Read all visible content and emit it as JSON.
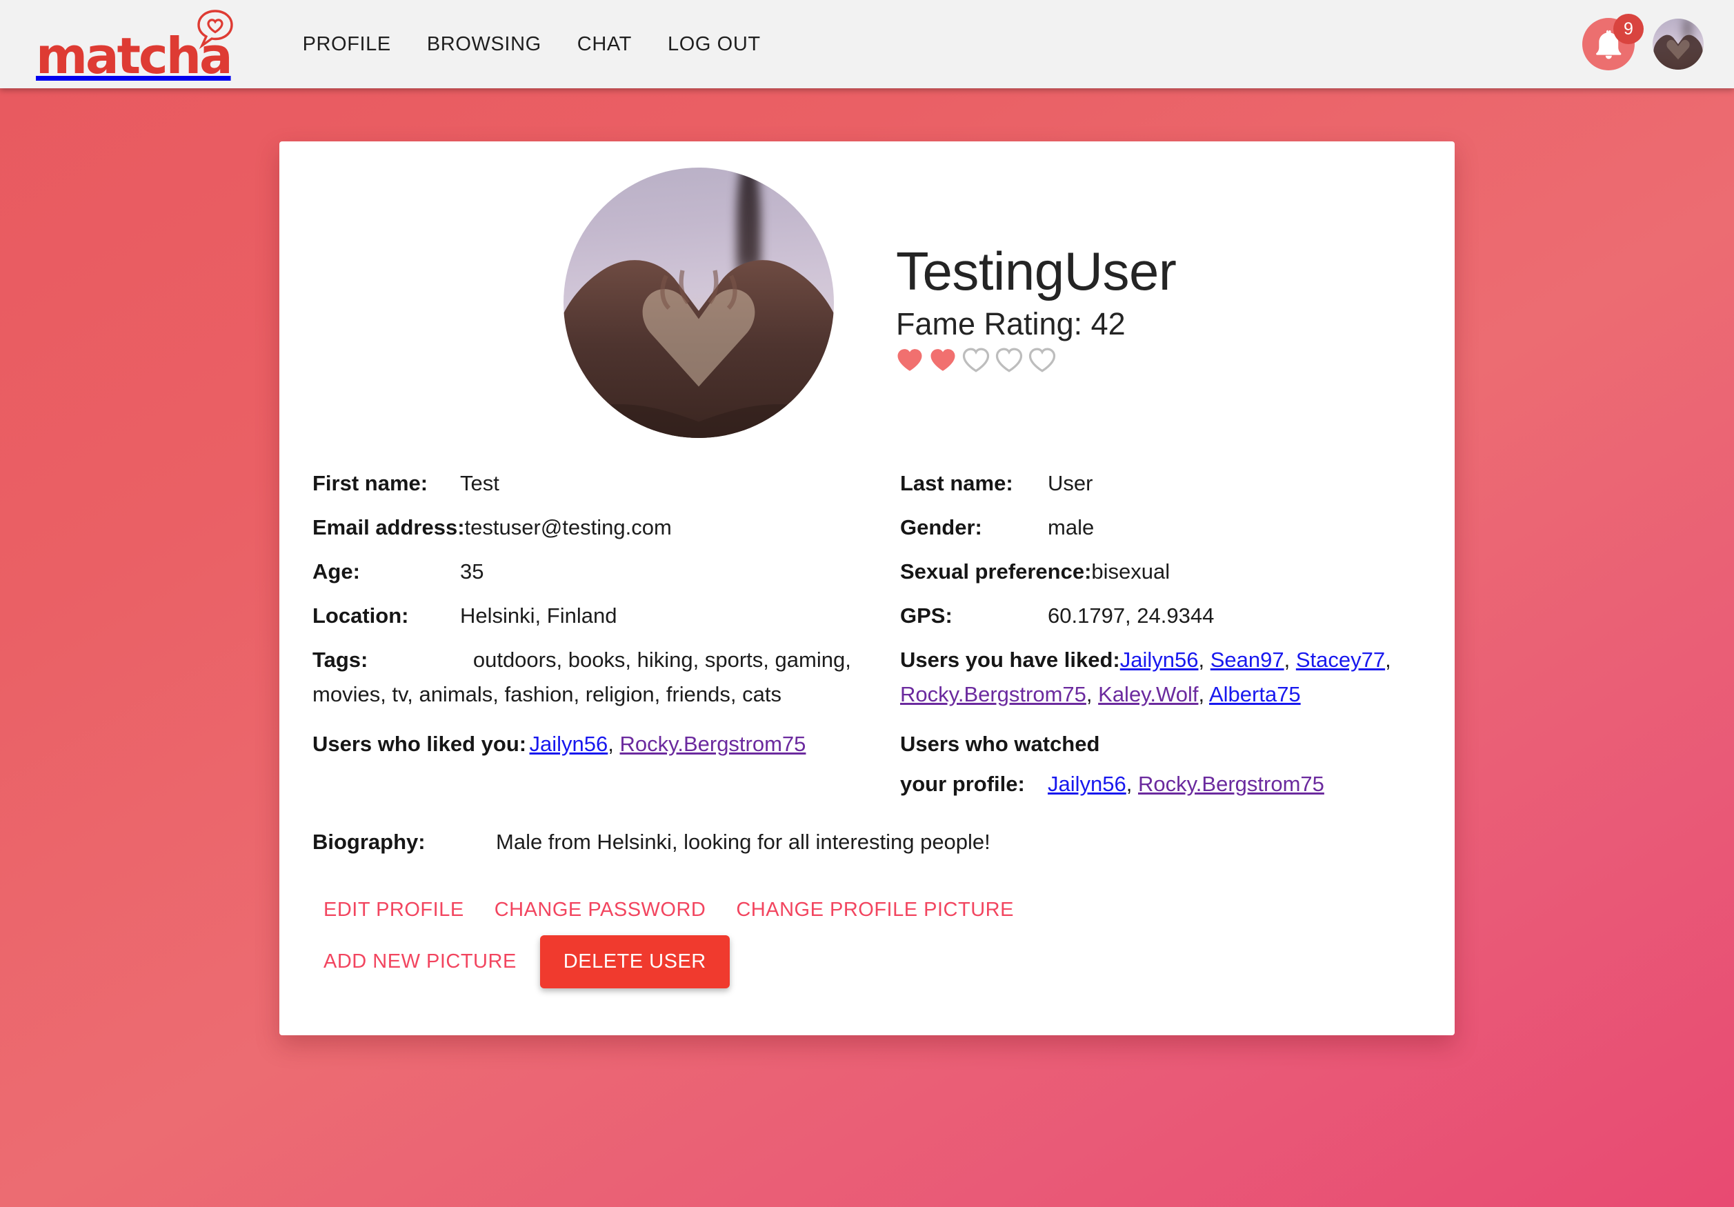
{
  "brand": {
    "name": "matcha",
    "logo_icon": "heart-speech-bubble-icon"
  },
  "nav": {
    "links": [
      {
        "label": "PROFILE",
        "name": "nav-link-profile"
      },
      {
        "label": "BROWSING",
        "name": "nav-link-browsing"
      },
      {
        "label": "CHAT",
        "name": "nav-link-chat"
      },
      {
        "label": "LOG OUT",
        "name": "nav-link-logout"
      }
    ],
    "notifications": {
      "icon": "bell-icon",
      "count": "9"
    },
    "avatar_icon": "user-avatar"
  },
  "profile": {
    "username": "TestingUser",
    "fame_label": "Fame Rating: 42",
    "fame_value": 42,
    "hearts_filled": 2,
    "hearts_total": 5,
    "picture_icon": "profile-picture"
  },
  "fields": {
    "first_name": {
      "label": "First name:",
      "value": "Test"
    },
    "last_name": {
      "label": "Last name:",
      "value": "User"
    },
    "email": {
      "label": "Email address:",
      "value": "testuser@testing.com"
    },
    "gender": {
      "label": "Gender:",
      "value": "male"
    },
    "age": {
      "label": "Age:",
      "value": "35"
    },
    "sexual_preference": {
      "label": "Sexual preference:",
      "value": "bisexual"
    },
    "location": {
      "label": "Location:",
      "value": "Helsinki, Finland"
    },
    "gps": {
      "label": "GPS:",
      "value": "60.1797, 24.9344"
    },
    "tags": {
      "label": "Tags:",
      "value": "outdoors, books, hiking, sports, gaming, movies, tv, animals, fashion, religion, friends, cats"
    },
    "biography": {
      "label": "Biography:",
      "value": "Male from Helsinki, looking for all interesting people!"
    }
  },
  "liked_by_you": {
    "label": "Users you have liked:",
    "users": [
      {
        "name": "Jailyn56",
        "visited": false
      },
      {
        "name": "Sean97",
        "visited": false
      },
      {
        "name": "Stacey77",
        "visited": false
      },
      {
        "name": "Rocky.Bergstrom75",
        "visited": true
      },
      {
        "name": "Kaley.Wolf",
        "visited": true
      },
      {
        "name": "Alberta75",
        "visited": false
      }
    ]
  },
  "liked_you": {
    "label": "Users who liked you:",
    "users": [
      {
        "name": "Jailyn56",
        "visited": false
      },
      {
        "name": "Rocky.Bergstrom75",
        "visited": true
      }
    ]
  },
  "watched_you": {
    "label_line1": "Users who watched",
    "label_line2": "your profile:",
    "users": [
      {
        "name": "Jailyn56",
        "visited": false
      },
      {
        "name": "Rocky.Bergstrom75",
        "visited": true
      }
    ]
  },
  "actions": {
    "edit_profile": "EDIT PROFILE",
    "change_password": "CHANGE PASSWORD",
    "change_profile_picture": "CHANGE PROFILE PICTURE",
    "add_new_picture": "ADD NEW PICTURE",
    "delete_user": "DELETE USER"
  },
  "colors": {
    "brand_red": "#de3b33",
    "accent_pink": "#f2455f",
    "danger": "#f03a2e",
    "heart_filled": "#f1706f",
    "heart_empty": "#bdbdbd",
    "navbar_bg": "#f2f2f2",
    "badge_bg": "#d9443f",
    "link": "#1818ee",
    "link_visited": "#6b2a9e"
  }
}
